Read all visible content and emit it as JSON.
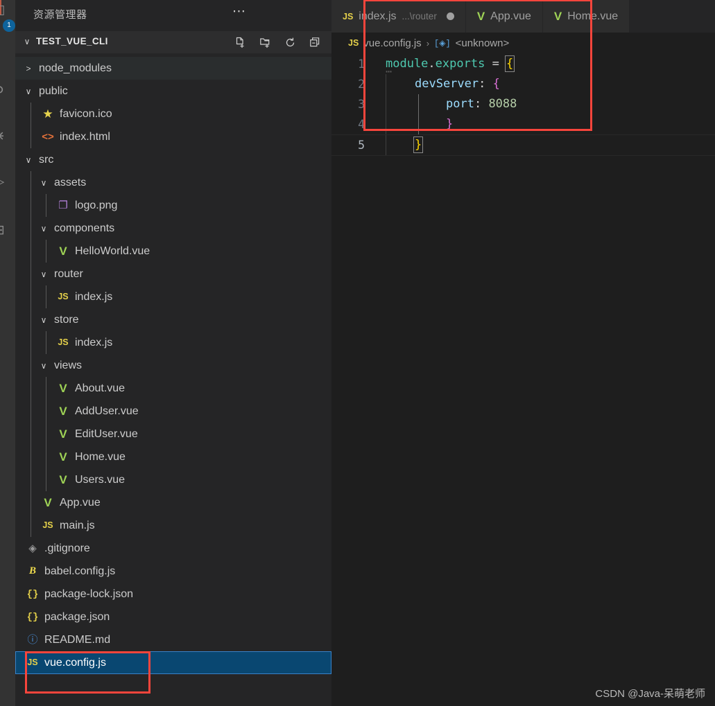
{
  "activity_bar": {
    "items": [
      {
        "name": "explorer-icon",
        "glyph": "❐",
        "badge": "1"
      },
      {
        "name": "search-icon",
        "glyph": "⌕"
      },
      {
        "name": "source-control-icon",
        "glyph": "⎇"
      },
      {
        "name": "run-debug-icon",
        "glyph": "▷"
      },
      {
        "name": "extensions-icon",
        "glyph": "⊞"
      }
    ]
  },
  "sidebar": {
    "title": "资源管理器",
    "more_actions": "⋯",
    "section": {
      "label": "TEST_VUE_CLI",
      "chevron": "∨",
      "actions": [
        {
          "name": "new-file-icon",
          "tooltip": "New File"
        },
        {
          "name": "new-folder-icon",
          "tooltip": "New Folder"
        },
        {
          "name": "refresh-icon",
          "tooltip": "Refresh Explorer"
        },
        {
          "name": "collapse-all-icon",
          "tooltip": "Collapse Folders in Explorer"
        }
      ]
    },
    "tree": [
      {
        "label": "node_modules",
        "type": "folder",
        "state": "collapsed",
        "depth": 0,
        "icon": "chevron-right-icon",
        "hover": true
      },
      {
        "label": "public",
        "type": "folder",
        "state": "expanded",
        "depth": 0,
        "icon": "chevron-down-icon"
      },
      {
        "label": "favicon.ico",
        "type": "file",
        "depth": 1,
        "icon": "star-icon"
      },
      {
        "label": "index.html",
        "type": "file",
        "depth": 1,
        "icon": "html-icon"
      },
      {
        "label": "src",
        "type": "folder",
        "state": "expanded",
        "depth": 0,
        "icon": "chevron-down-icon"
      },
      {
        "label": "assets",
        "type": "folder",
        "state": "expanded",
        "depth": 1,
        "icon": "chevron-down-icon"
      },
      {
        "label": "logo.png",
        "type": "file",
        "depth": 2,
        "icon": "image-icon"
      },
      {
        "label": "components",
        "type": "folder",
        "state": "expanded",
        "depth": 1,
        "icon": "chevron-down-icon"
      },
      {
        "label": "HelloWorld.vue",
        "type": "file",
        "depth": 2,
        "icon": "vue-icon"
      },
      {
        "label": "router",
        "type": "folder",
        "state": "expanded",
        "depth": 1,
        "icon": "chevron-down-icon"
      },
      {
        "label": "index.js",
        "type": "file",
        "depth": 2,
        "icon": "js-icon"
      },
      {
        "label": "store",
        "type": "folder",
        "state": "expanded",
        "depth": 1,
        "icon": "chevron-down-icon"
      },
      {
        "label": "index.js",
        "type": "file",
        "depth": 2,
        "icon": "js-icon"
      },
      {
        "label": "views",
        "type": "folder",
        "state": "expanded",
        "depth": 1,
        "icon": "chevron-down-icon"
      },
      {
        "label": "About.vue",
        "type": "file",
        "depth": 2,
        "icon": "vue-icon"
      },
      {
        "label": "AddUser.vue",
        "type": "file",
        "depth": 2,
        "icon": "vue-icon"
      },
      {
        "label": "EditUser.vue",
        "type": "file",
        "depth": 2,
        "icon": "vue-icon"
      },
      {
        "label": "Home.vue",
        "type": "file",
        "depth": 2,
        "icon": "vue-icon"
      },
      {
        "label": "Users.vue",
        "type": "file",
        "depth": 2,
        "icon": "vue-icon"
      },
      {
        "label": "App.vue",
        "type": "file",
        "depth": 1,
        "icon": "vue-icon"
      },
      {
        "label": "main.js",
        "type": "file",
        "depth": 1,
        "icon": "js-icon"
      },
      {
        "label": ".gitignore",
        "type": "file",
        "depth": 0,
        "icon": "git-icon"
      },
      {
        "label": "babel.config.js",
        "type": "file",
        "depth": 0,
        "icon": "babel-icon"
      },
      {
        "label": "package-lock.json",
        "type": "file",
        "depth": 0,
        "icon": "json-icon"
      },
      {
        "label": "package.json",
        "type": "file",
        "depth": 0,
        "icon": "json-icon"
      },
      {
        "label": "README.md",
        "type": "file",
        "depth": 0,
        "icon": "markdown-icon"
      },
      {
        "label": "vue.config.js",
        "type": "file",
        "depth": 0,
        "icon": "js-icon",
        "selected": true
      }
    ]
  },
  "editor": {
    "tabs": [
      {
        "label": "index.js",
        "description": "...\\router",
        "icon": "js-icon",
        "dirty": true,
        "active": false
      },
      {
        "label": "App.vue",
        "description": "",
        "icon": "vue-icon",
        "dirty": false,
        "active": false
      },
      {
        "label": "Home.vue",
        "description": "",
        "icon": "vue-icon",
        "dirty": false,
        "active": false
      }
    ],
    "breadcrumb": {
      "file_icon": "js-icon",
      "file": "vue.config.js",
      "separator": "›",
      "symbol_icon": "module-symbol-icon",
      "symbol": "<unknown>"
    },
    "code": {
      "language": "javascript",
      "lines": [
        {
          "number": "1",
          "text": "module.exports = {"
        },
        {
          "number": "2",
          "text": "    devServer: {"
        },
        {
          "number": "3",
          "text": "        port: 8088"
        },
        {
          "number": "4",
          "text": "        }"
        },
        {
          "number": "5",
          "text": "    }"
        }
      ],
      "current_line": "5",
      "port_value": "8088"
    }
  },
  "annotations": {
    "code_box_color": "#f8453c",
    "file_box_color": "#f8453c"
  },
  "watermark": "CSDN @Java-呆萌老师"
}
